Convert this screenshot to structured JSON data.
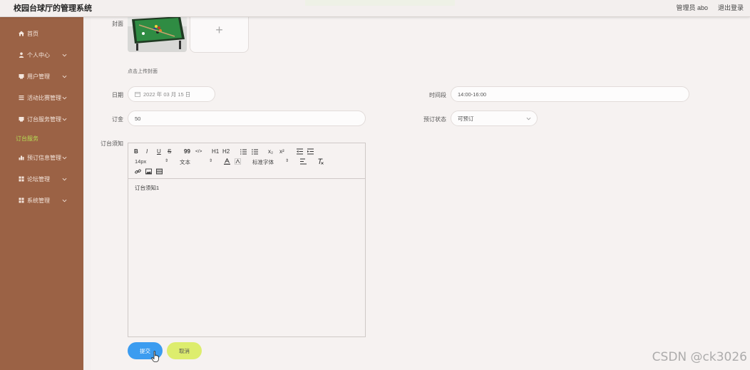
{
  "app": {
    "title": "校园台球厅的管理系统",
    "admin_label": "管理员 abo",
    "logout_label": "退出登录"
  },
  "sidebar": {
    "items": [
      {
        "label": "首页",
        "icon": "home-icon"
      },
      {
        "label": "个人中心",
        "icon": "person-icon"
      },
      {
        "label": "用户管理",
        "icon": "user-manage-icon"
      },
      {
        "label": "活动比赛管理",
        "icon": "list-icon"
      },
      {
        "label": "订台服务管理",
        "icon": "service-icon"
      },
      {
        "label": "预订信息管理",
        "icon": "chart-icon"
      },
      {
        "label": "论坛管理",
        "icon": "grid-icon"
      },
      {
        "label": "系统管理",
        "icon": "grid-icon"
      }
    ],
    "active_sub": "订台服务"
  },
  "form": {
    "cover_label": "封面",
    "upload_hint": "点击上传封面",
    "date_label": "日期",
    "date_value": "2022 年 03 月 15 日",
    "period_label": "时间段",
    "period_value": "14:00-16:00",
    "deposit_label": "订金",
    "deposit_value": "50",
    "status_label": "预订状态",
    "status_value": "可预订",
    "notice_label": "订台须知",
    "notice_content": "订台须知1"
  },
  "editor": {
    "bold": "B",
    "italic": "I",
    "underline": "U",
    "strike": "S",
    "quote": "99",
    "code": "</>",
    "h1": "H1",
    "h2": "H2",
    "sub": "x₂",
    "sup": "x²",
    "font_size": "14px",
    "text_type": "文本",
    "font_family": "标准字体"
  },
  "buttons": {
    "submit": "提交",
    "cancel": "取消"
  },
  "watermark": "CSDN @ck3026",
  "colors": {
    "sidebar": "#9b6245",
    "submit": "#3b9cf0",
    "cancel": "#dded6d",
    "active_sub": "#b6dd55"
  }
}
